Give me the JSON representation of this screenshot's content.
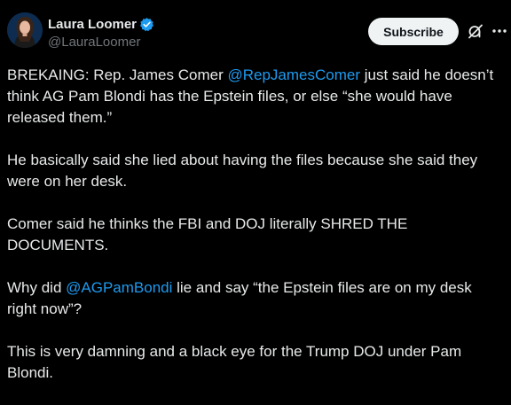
{
  "author": {
    "display_name": "Laura Loomer",
    "handle": "@LauraLoomer",
    "verified": true,
    "verified_color": "#1d9bf0"
  },
  "actions": {
    "subscribe_label": "Subscribe",
    "grok_icon": "grok-icon",
    "more_icon": "more-icon"
  },
  "tweet": {
    "p1_a": "BREKAING: Rep. James Comer ",
    "p1_mention": "@RepJamesComer",
    "p1_b": " just said he doesn’t think AG Pam Blondi has the Epstein files, or else “she would have released them.”",
    "p2": "He basically said she lied about having the files because she said they were on her desk.",
    "p3": "Comer said he thinks the FBI and DOJ literally SHRED THE DOCUMENTS.",
    "p4_a": "Why did ",
    "p4_mention": "@AGPamBondi",
    "p4_b": " lie and say “the Epstein files are on my desk right now”?",
    "p5": "This is very damning and a black eye for the Trump DOJ under Pam Blondi."
  },
  "colors": {
    "background": "#000000",
    "text": "#e7e9ea",
    "secondary": "#71767b",
    "link": "#1d9bf0",
    "button_bg": "#eff3f4"
  }
}
